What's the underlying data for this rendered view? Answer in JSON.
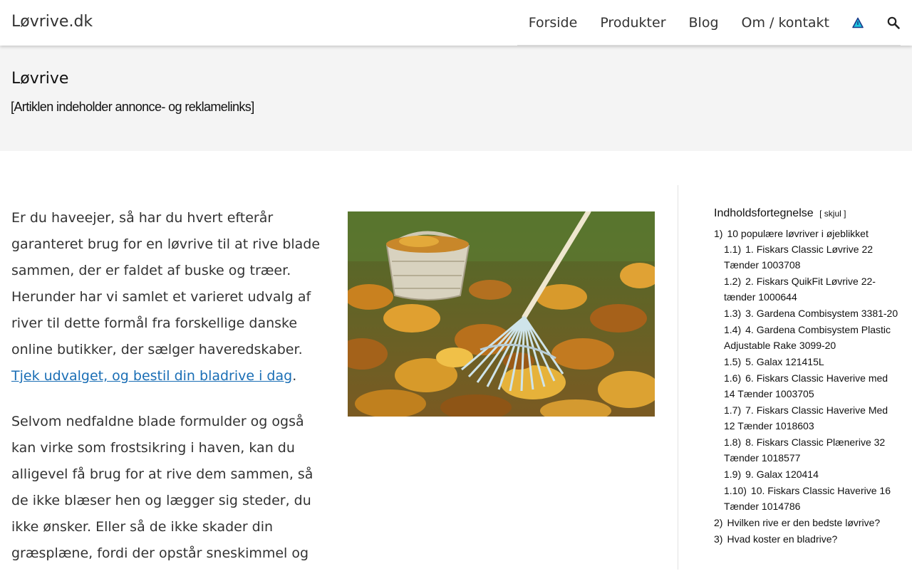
{
  "header": {
    "logo": "Løvrive.dk",
    "nav": [
      "Forside",
      "Produkter",
      "Blog",
      "Om / kontakt"
    ]
  },
  "band": {
    "title": "Løvrive",
    "disclaimer": "[Artiklen indeholder annonce- og reklamelinks]"
  },
  "article": {
    "p1": "Er du haveejer, så har du hvert efterår garanteret brug for en løvrive til at rive blade sammen, der er faldet af buske og træer. Herunder har vi samlet et varieret udvalg af river til dette formål fra forskellige danske online butikker, der sælger haveredskaber.",
    "p1_link": "Tjek udvalget, og bestil din bladrive i dag",
    "p1_end": ".",
    "p2": "Selvom nedfaldne blade formulder og også kan virke som frostsikring i haven, kan du alligevel få brug for at rive dem sammen, så de ikke blæser hen og lægger sig steder, du ikke ønsker. Eller så de ikke skader din græsplæne, fordi der opstår sneskimmel og"
  },
  "toc": {
    "title": "Indholdsfortegnelse",
    "toggle": "skjul",
    "items": [
      {
        "num": "1)",
        "label": "10 populære løvriver i øjeblikket"
      },
      {
        "num": "1.1)",
        "label": "1. Fiskars Classic Løvrive 22 Tænder 1003708"
      },
      {
        "num": "1.2)",
        "label": "2. Fiskars QuikFit Løvrive 22-tænder 1000644"
      },
      {
        "num": "1.3)",
        "label": "3. Gardena Combisystem 3381-20"
      },
      {
        "num": "1.4)",
        "label": "4. Gardena Combisystem Plastic Adjustable Rake 3099-20"
      },
      {
        "num": "1.5)",
        "label": "5. Galax 121415L"
      },
      {
        "num": "1.6)",
        "label": "6. Fiskars Classic Haverive med 14 Tænder 1003705"
      },
      {
        "num": "1.7)",
        "label": "7. Fiskars Classic Haverive Med 12 Tænder 1018603"
      },
      {
        "num": "1.8)",
        "label": "8. Fiskars Classic Plænerive 32 Tænder 1018577"
      },
      {
        "num": "1.9)",
        "label": "9. Galax 120414"
      },
      {
        "num": "1.10)",
        "label": "10. Fiskars Classic Haverive 16 Tænder 1014786"
      },
      {
        "num": "2)",
        "label": "Hvilken rive er den bedste løvrive?"
      },
      {
        "num": "3)",
        "label": "Hvad koster en bladrive?"
      }
    ]
  },
  "colors": {
    "link": "#1a6eb5",
    "band_bg": "#f4f4f4",
    "warning_icon": "#00bcd4"
  },
  "icons": {
    "warning": "warning-triangle-icon",
    "search": "search-icon"
  }
}
